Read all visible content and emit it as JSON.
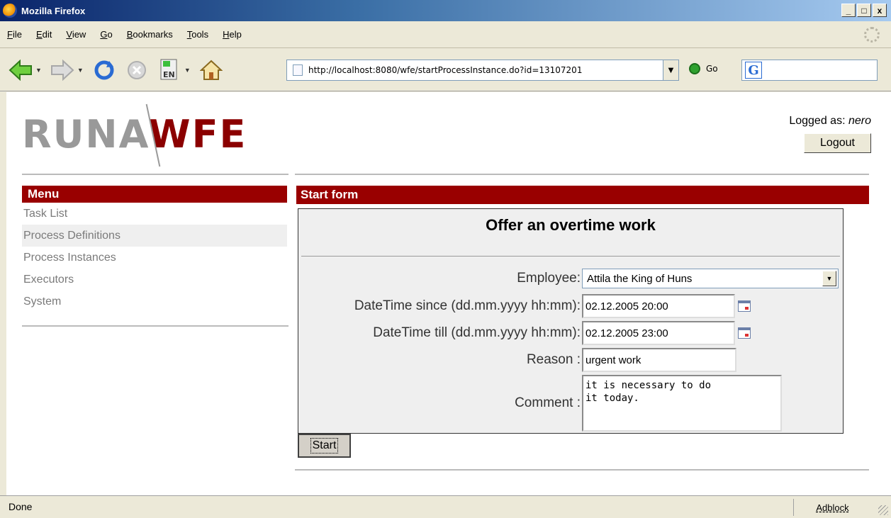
{
  "window": {
    "title": "Mozilla Firefox",
    "min": "_",
    "max": "□",
    "close": "x"
  },
  "menubar": [
    "File",
    "Edit",
    "View",
    "Go",
    "Bookmarks",
    "Tools",
    "Help"
  ],
  "toolbar": {
    "url": "http://localhost:8080/wfe/startProcessInstance.do?id=13107201",
    "go_label": "Go",
    "search_logo": "G",
    "lang_badge": "EN"
  },
  "header": {
    "logo_part1": "RUNA",
    "logo_part2": "WFE",
    "logged_as_label": "Logged as:",
    "user": "nero",
    "logout_label": "Logout"
  },
  "menu": {
    "title": "Menu",
    "items": [
      "Task List",
      "Process Definitions",
      "Process Instances",
      "Executors",
      "System"
    ]
  },
  "form": {
    "section_title": "Start form",
    "title": "Offer an overtime work",
    "employee_label": "Employee:",
    "employee_value": "Attila the King of Huns",
    "since_label": "DateTime since (dd.mm.yyyy hh:mm):",
    "since_value": "02.12.2005 20:00",
    "till_label": "DateTime till (dd.mm.yyyy hh:mm):",
    "till_value": "02.12.2005 23:00",
    "reason_label": "Reason :",
    "reason_value": "urgent work",
    "comment_label": "Comment :",
    "comment_value": "it is necessary to do\nit today.",
    "start_label": "Start"
  },
  "status": {
    "text": "Done",
    "adblock": "Adblock"
  }
}
